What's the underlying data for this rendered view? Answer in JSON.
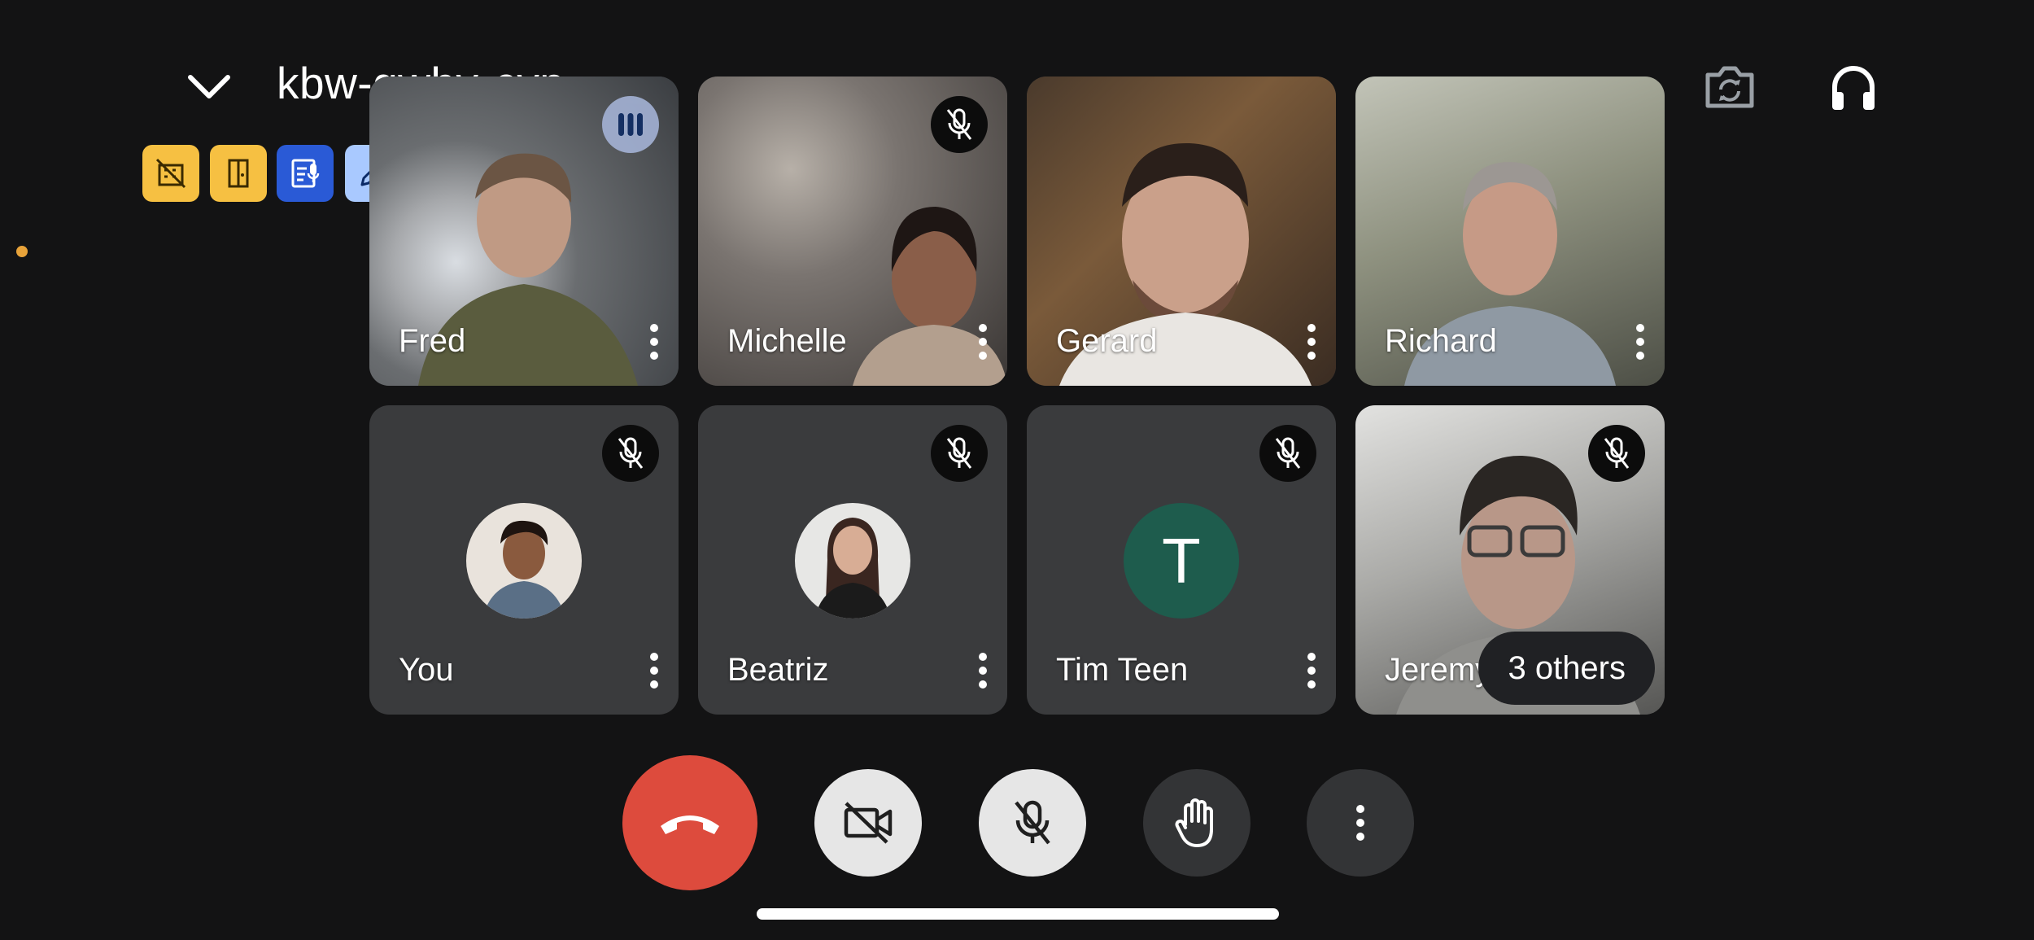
{
  "header": {
    "meeting_code": "kbw-gwhv-cvp",
    "collapse_icon": "chevron-down-icon",
    "switch_camera_icon": "switch-camera-icon",
    "audio_output_icon": "headphones-icon"
  },
  "status_chips": [
    {
      "icon": "background-off-icon",
      "color": "#f6c042"
    },
    {
      "icon": "door-icon",
      "color": "#f6c042"
    },
    {
      "icon": "transcript-icon",
      "color": "#2a5ad6"
    },
    {
      "icon": "edit-sparkle-icon",
      "color": "#a9c9ff"
    }
  ],
  "participants": [
    {
      "name": "Fred"
    },
    {
      "name": "Michelle"
    },
    {
      "name": "Gerard"
    },
    {
      "name": "Richard"
    },
    {
      "name": "You"
    },
    {
      "name": "Beatriz"
    },
    {
      "name": "Tim Teen",
      "initial": "T"
    },
    {
      "name": "Jeremy"
    }
  ],
  "others_label": "3 others",
  "controls": {
    "end_call_icon": "phone-hangup-icon",
    "camera_icon": "video-off-icon",
    "mic_icon": "mic-off-icon",
    "hand_icon": "raise-hand-icon",
    "more_icon": "more-vertical-icon"
  },
  "colors": {
    "background": "#131314",
    "end_call": "#dd4b3d",
    "accent_yellow": "#f6c042",
    "accent_blue": "#2a5ad6",
    "avatar_green": "#1e5c4d"
  }
}
